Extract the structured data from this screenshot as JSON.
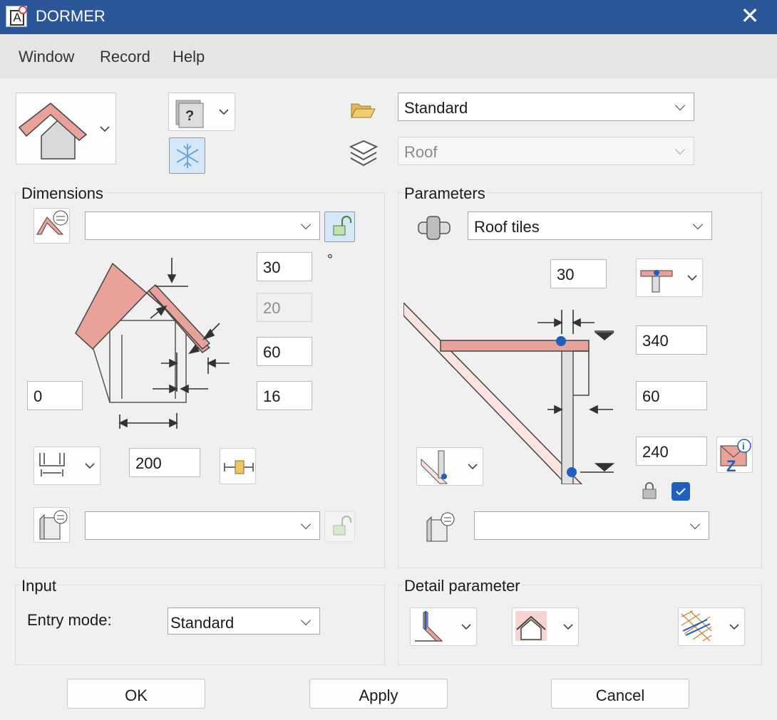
{
  "window": {
    "title": "DORMER",
    "close": "✕"
  },
  "menu": [
    "Window",
    "Record",
    "Help"
  ],
  "top": {
    "style_combo": "Standard",
    "layer_combo": "Roof"
  },
  "dimensions": {
    "title": "Dimensions",
    "profile_combo": "",
    "angle": "30",
    "angle_unit": "°",
    "overhang_disabled": "20",
    "thickness": "60",
    "offset": "16",
    "left_value": "0",
    "width_value": "200",
    "bottom_combo": ""
  },
  "parameters": {
    "title": "Parameters",
    "material_combo": "Roof tiles",
    "value_top": "30",
    "height1": "340",
    "width2": "60",
    "height3": "240"
  },
  "input": {
    "title": "Input",
    "entry_mode_label": "Entry mode:",
    "entry_mode_value": "Standard"
  },
  "detail": {
    "title": "Detail parameter"
  },
  "buttons": {
    "ok": "OK",
    "apply": "Apply",
    "cancel": "Cancel"
  },
  "colors": {
    "titlebar": "#2b579a",
    "roof_red": "#e8a29a",
    "accent_blue": "#1f5fc0"
  }
}
